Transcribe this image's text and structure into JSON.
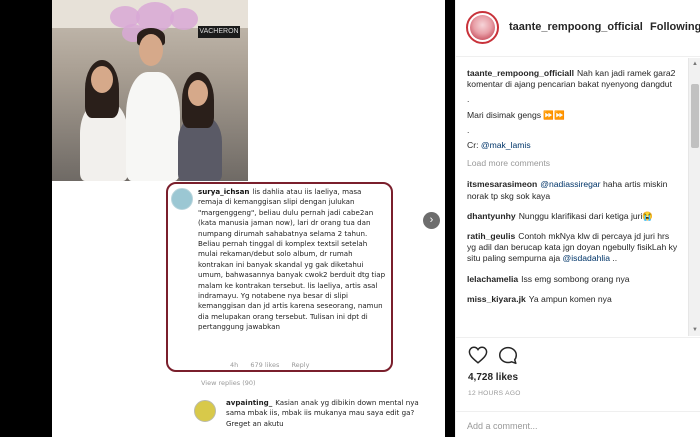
{
  "post": {
    "comment_card": {
      "username": "surya_ichsan",
      "text": "lis dahlia atau iis laeliya, masa remaja di kemanggisan slipi dengan julukan \"margenggeng\", beliau dulu pernah jadi cabe2an (kata manusia jaman now), lari dr orang tua dan numpang dirumah sahabatnya selama 2 tahun. Beliau pernah tinggal di komplex textsil setelah mulai rekaman/debut solo album, dr rumah kontrakan ini banyak skandal yg gak diketahui umum, bahwasannya banyak cwok2 berduit dtg tiap malam ke kontrakan tersebut. lis laeliya, artis asal indramayu. Yg notabene nya besar di slipi kemanggisan dan jd artis karena seseorang, namun dia melupakan orang tersebut. Tulisan ini dpt di pertanggung jawabkan",
      "time": "4h",
      "likes": "679 likes",
      "reply": "Reply",
      "view_replies": "View replies (90)"
    },
    "comment2": {
      "username": "avpainting_",
      "text": "Kasian anak yg dibikin down mental nya sama mbak iis, mbak iis mukanya mau saya edit ga? Greget an akutu"
    },
    "photo_sign": "VACHERON",
    "next_arrow": "›"
  },
  "sidebar": {
    "username": "taante_rempoong_official",
    "follow": "Following",
    "caption": {
      "username": "taante_rempoong_officiall",
      "line1": "Nah kan jadi ramek gara2 komentar di ajang pencarian bakat nyenyong dangdut",
      "line2": ".",
      "line3": "Mari disimak gengs ⏩⏩",
      "line4": ".",
      "credit_prefix": "Cr: ",
      "credit_handle": "@mak_lamis"
    },
    "load_more": "Load more comments",
    "comments": [
      {
        "user": "itsmesarasimeon",
        "mention": "@nadiassiregar",
        "text": "haha artis miskin norak tp skg sok kaya"
      },
      {
        "user": "dhantyunhy",
        "mention": "",
        "text": "Nunggu klarifikasi dari ketiga juri😭"
      },
      {
        "user": "ratih_geulis",
        "mention": "",
        "text": "Contoh mkNya klw di percaya jd juri hrs yg adil dan berucap kata jgn doyan ngebully fisikLah ky situ paling sempurna aja",
        "mention_end": "@isdadahlia",
        "suffix": " .."
      },
      {
        "user": "lelachamelia",
        "mention": "",
        "text": "Iss emg sombong orang nya"
      },
      {
        "user": "miss_kiyara.jk",
        "mention": "",
        "text": "Ya ampun komen nya"
      }
    ],
    "likes": "4,728 likes",
    "time_ago": "12 HOURS AGO",
    "add_comment_placeholder": "Add a comment..."
  },
  "colors": {
    "accent_card_border": "#7a1f2c",
    "link": "#003569",
    "profile_ring": "#c8323a"
  }
}
